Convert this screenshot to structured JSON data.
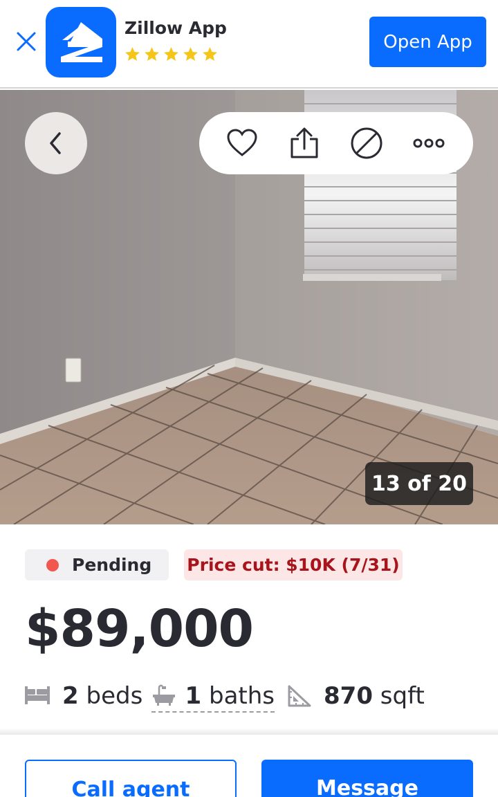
{
  "banner": {
    "app_name": "Zillow App",
    "rating_stars": 5,
    "open_label": "Open App",
    "brand_color": "#0a6cff",
    "star_color": "#f5c518"
  },
  "photo": {
    "counter": "13 of 20"
  },
  "listing": {
    "status_label": "Pending",
    "status_color": "#f2574f",
    "price_cut_label": "Price cut: $10K (7/31)",
    "price": "$89,000",
    "beds_value": "2",
    "beds_unit": "beds",
    "baths_value": "1",
    "baths_unit": "baths",
    "sqft_value": "870",
    "sqft_unit": "sqft"
  },
  "actions": {
    "call_label": "Call agent",
    "message_label": "Message"
  },
  "icons": [
    "close-icon",
    "zillow-logo-icon",
    "star-icon",
    "chevron-left-icon",
    "heart-icon",
    "share-icon",
    "hide-icon",
    "more-icon",
    "bed-icon",
    "bath-icon",
    "sqft-icon"
  ]
}
